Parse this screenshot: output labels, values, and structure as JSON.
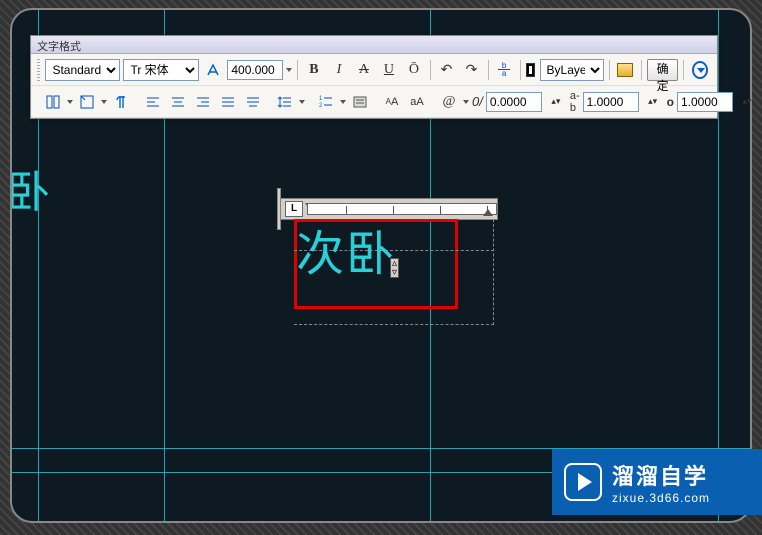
{
  "window": {
    "title": "文字格式"
  },
  "row1": {
    "style": "Standard",
    "font_prefix": "Tr",
    "font": "宋体",
    "annotative_icon": "annotative-icon",
    "height": "400.000",
    "bold": "B",
    "italic": "I",
    "strike": "A",
    "underline": "U",
    "overline": "Ō",
    "undo": "↶",
    "redo": "↷",
    "stack_top": "b",
    "stack_bot": "a",
    "color": "ByLayer",
    "ruler_icon": "ruler-icon",
    "ok": "确定"
  },
  "row2": {
    "at": "@",
    "oblique": "0/",
    "tracking": "0.0000",
    "width_prefix": "a-b",
    "width": "1.0000",
    "height_prefix": "o",
    "height": "1.0000",
    "caseA": "A",
    "caseAa": "aA"
  },
  "text_edit": {
    "content": "次卧",
    "ruler_L": "L"
  },
  "partial": "卧",
  "watermark": {
    "big": "溜溜自学",
    "small": "zixue.3d66.com"
  }
}
